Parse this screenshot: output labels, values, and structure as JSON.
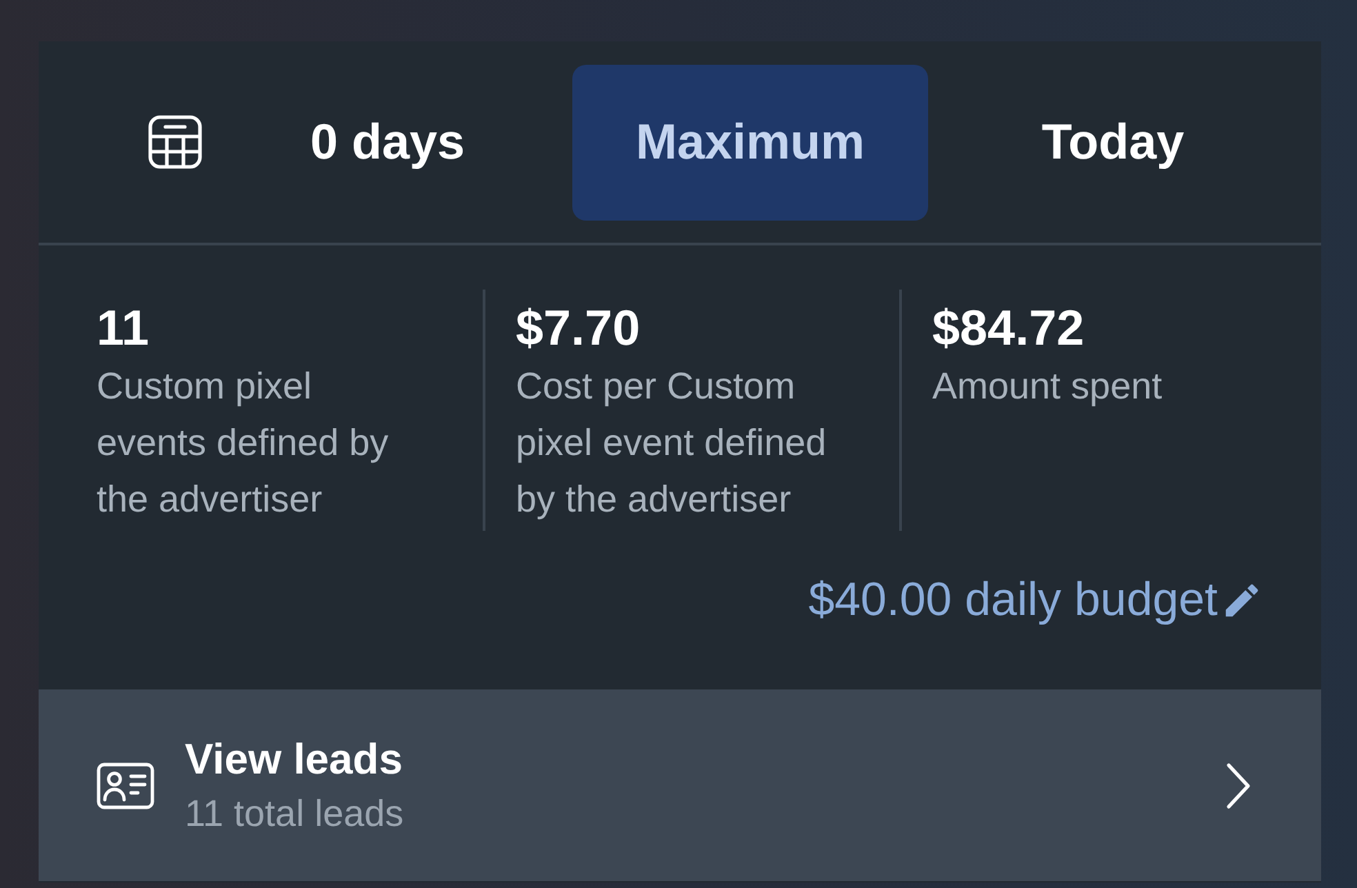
{
  "tabs": [
    {
      "label": "0 days",
      "selected": false
    },
    {
      "label": "Maximum",
      "selected": true
    },
    {
      "label": "Today",
      "selected": false
    }
  ],
  "metrics": [
    {
      "value": "11",
      "label": "Custom pixel events defined by the advertiser"
    },
    {
      "value": "$7.70",
      "label": "Cost per Custom pixel event defined by the advertiser"
    },
    {
      "value": "$84.72",
      "label": "Amount spent"
    }
  ],
  "budget": {
    "text": "$40.00 daily budget"
  },
  "leads_row": {
    "title": "View leads",
    "subtitle": "11 total leads"
  }
}
